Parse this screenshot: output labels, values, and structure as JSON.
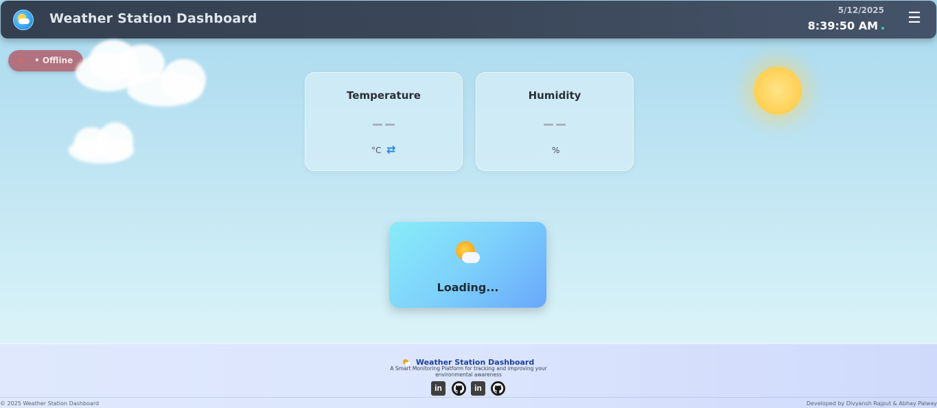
{
  "header": {
    "title": "Weather Station Dashboard",
    "date": "5/12/2025",
    "time": "8:39:50 AM",
    "menu_icon": "hamburger-menu-icon",
    "menu_glyph": "☰"
  },
  "status": {
    "label": "• Offline",
    "color": "#b04e5a"
  },
  "cards": {
    "temperature": {
      "title": "Temperature",
      "unit": "°C",
      "swap_glyph": "⇄"
    },
    "humidity": {
      "title": "Humidity",
      "unit": "%"
    }
  },
  "loading": {
    "text": "Loading..."
  },
  "footer": {
    "title": "Weather Station Dashboard",
    "tagline": "A Smart Monitoring Platform for tracking and improving your environmental awareness",
    "social": [
      {
        "icon": "linkedin-icon",
        "glyph": "in"
      },
      {
        "icon": "github-icon"
      },
      {
        "icon": "linkedin-icon",
        "glyph": "in"
      },
      {
        "icon": "github-icon"
      }
    ],
    "copyright": "© 2025 Weather Station Dashboard",
    "developed_by": "Developed by Divyansh Rajput & Abhay Palway"
  },
  "colors": {
    "header_bg": "#3b4759",
    "accent": "#1f86e0",
    "offline": "#b04e5a",
    "footer_title": "#1c3f9e"
  }
}
